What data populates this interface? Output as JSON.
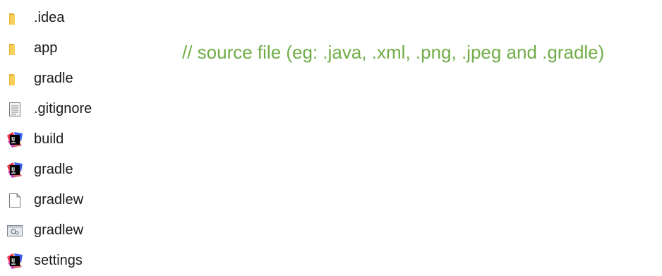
{
  "files": [
    {
      "name": ".idea",
      "icon": "folder-icon"
    },
    {
      "name": "app",
      "icon": "folder-icon"
    },
    {
      "name": "gradle",
      "icon": "folder-icon"
    },
    {
      "name": ".gitignore",
      "icon": "text-file-icon"
    },
    {
      "name": "build",
      "icon": "intellij-file-icon"
    },
    {
      "name": "gradle",
      "icon": "intellij-file-icon"
    },
    {
      "name": "gradlew",
      "icon": "blank-file-icon"
    },
    {
      "name": "gradlew",
      "icon": "settings-file-icon"
    },
    {
      "name": "settings",
      "icon": "intellij-file-icon"
    }
  ],
  "annotation": {
    "text": "// source file (eg: .java, .xml, .png, .jpeg and .gradle)",
    "color": "#70ad47"
  },
  "colors": {
    "folder": "#f5c84c",
    "text": "#1a1a1a"
  }
}
